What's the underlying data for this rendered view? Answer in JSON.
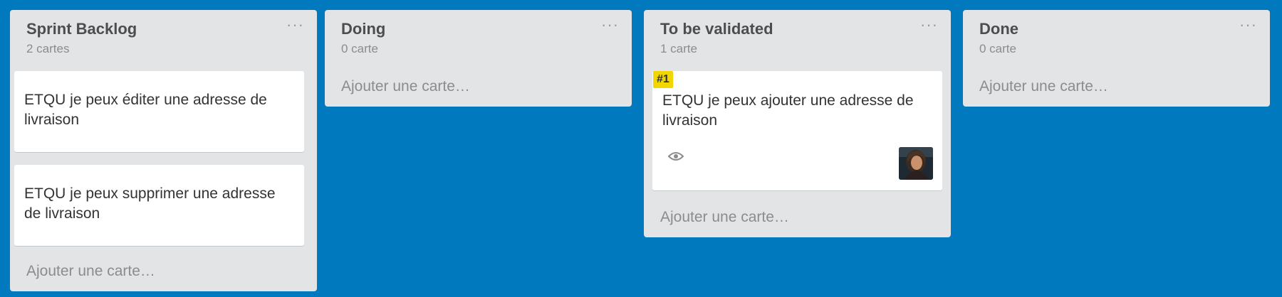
{
  "lists": [
    {
      "title": "Sprint Backlog",
      "count": "2 cartes",
      "menu": "···",
      "cards": [
        {
          "text": "ETQU je peux éditer une adresse de livraison"
        },
        {
          "text": "ETQU je peux supprimer une adresse de livraison"
        }
      ],
      "add_card": "Ajouter une carte…"
    },
    {
      "title": "Doing",
      "count": "0 carte",
      "menu": "···",
      "cards": [],
      "add_card": "Ajouter une carte…"
    },
    {
      "title": "To be validated",
      "count": "1 carte",
      "menu": "···",
      "cards": [
        {
          "label": "#1",
          "label_color": "#f2d600",
          "text": "ETQU je peux ajouter une adresse de livraison",
          "icons": [
            "eye-icon"
          ],
          "member": "avatar"
        }
      ],
      "add_card": "Ajouter une carte…"
    },
    {
      "title": "Done",
      "count": "0 carte",
      "menu": "···",
      "cards": [],
      "add_card": "Ajouter une carte…"
    }
  ],
  "colors": {
    "board_background": "#0079bf",
    "list_background": "#e2e4e6",
    "card_background": "#ffffff",
    "label_yellow": "#f2d600"
  }
}
